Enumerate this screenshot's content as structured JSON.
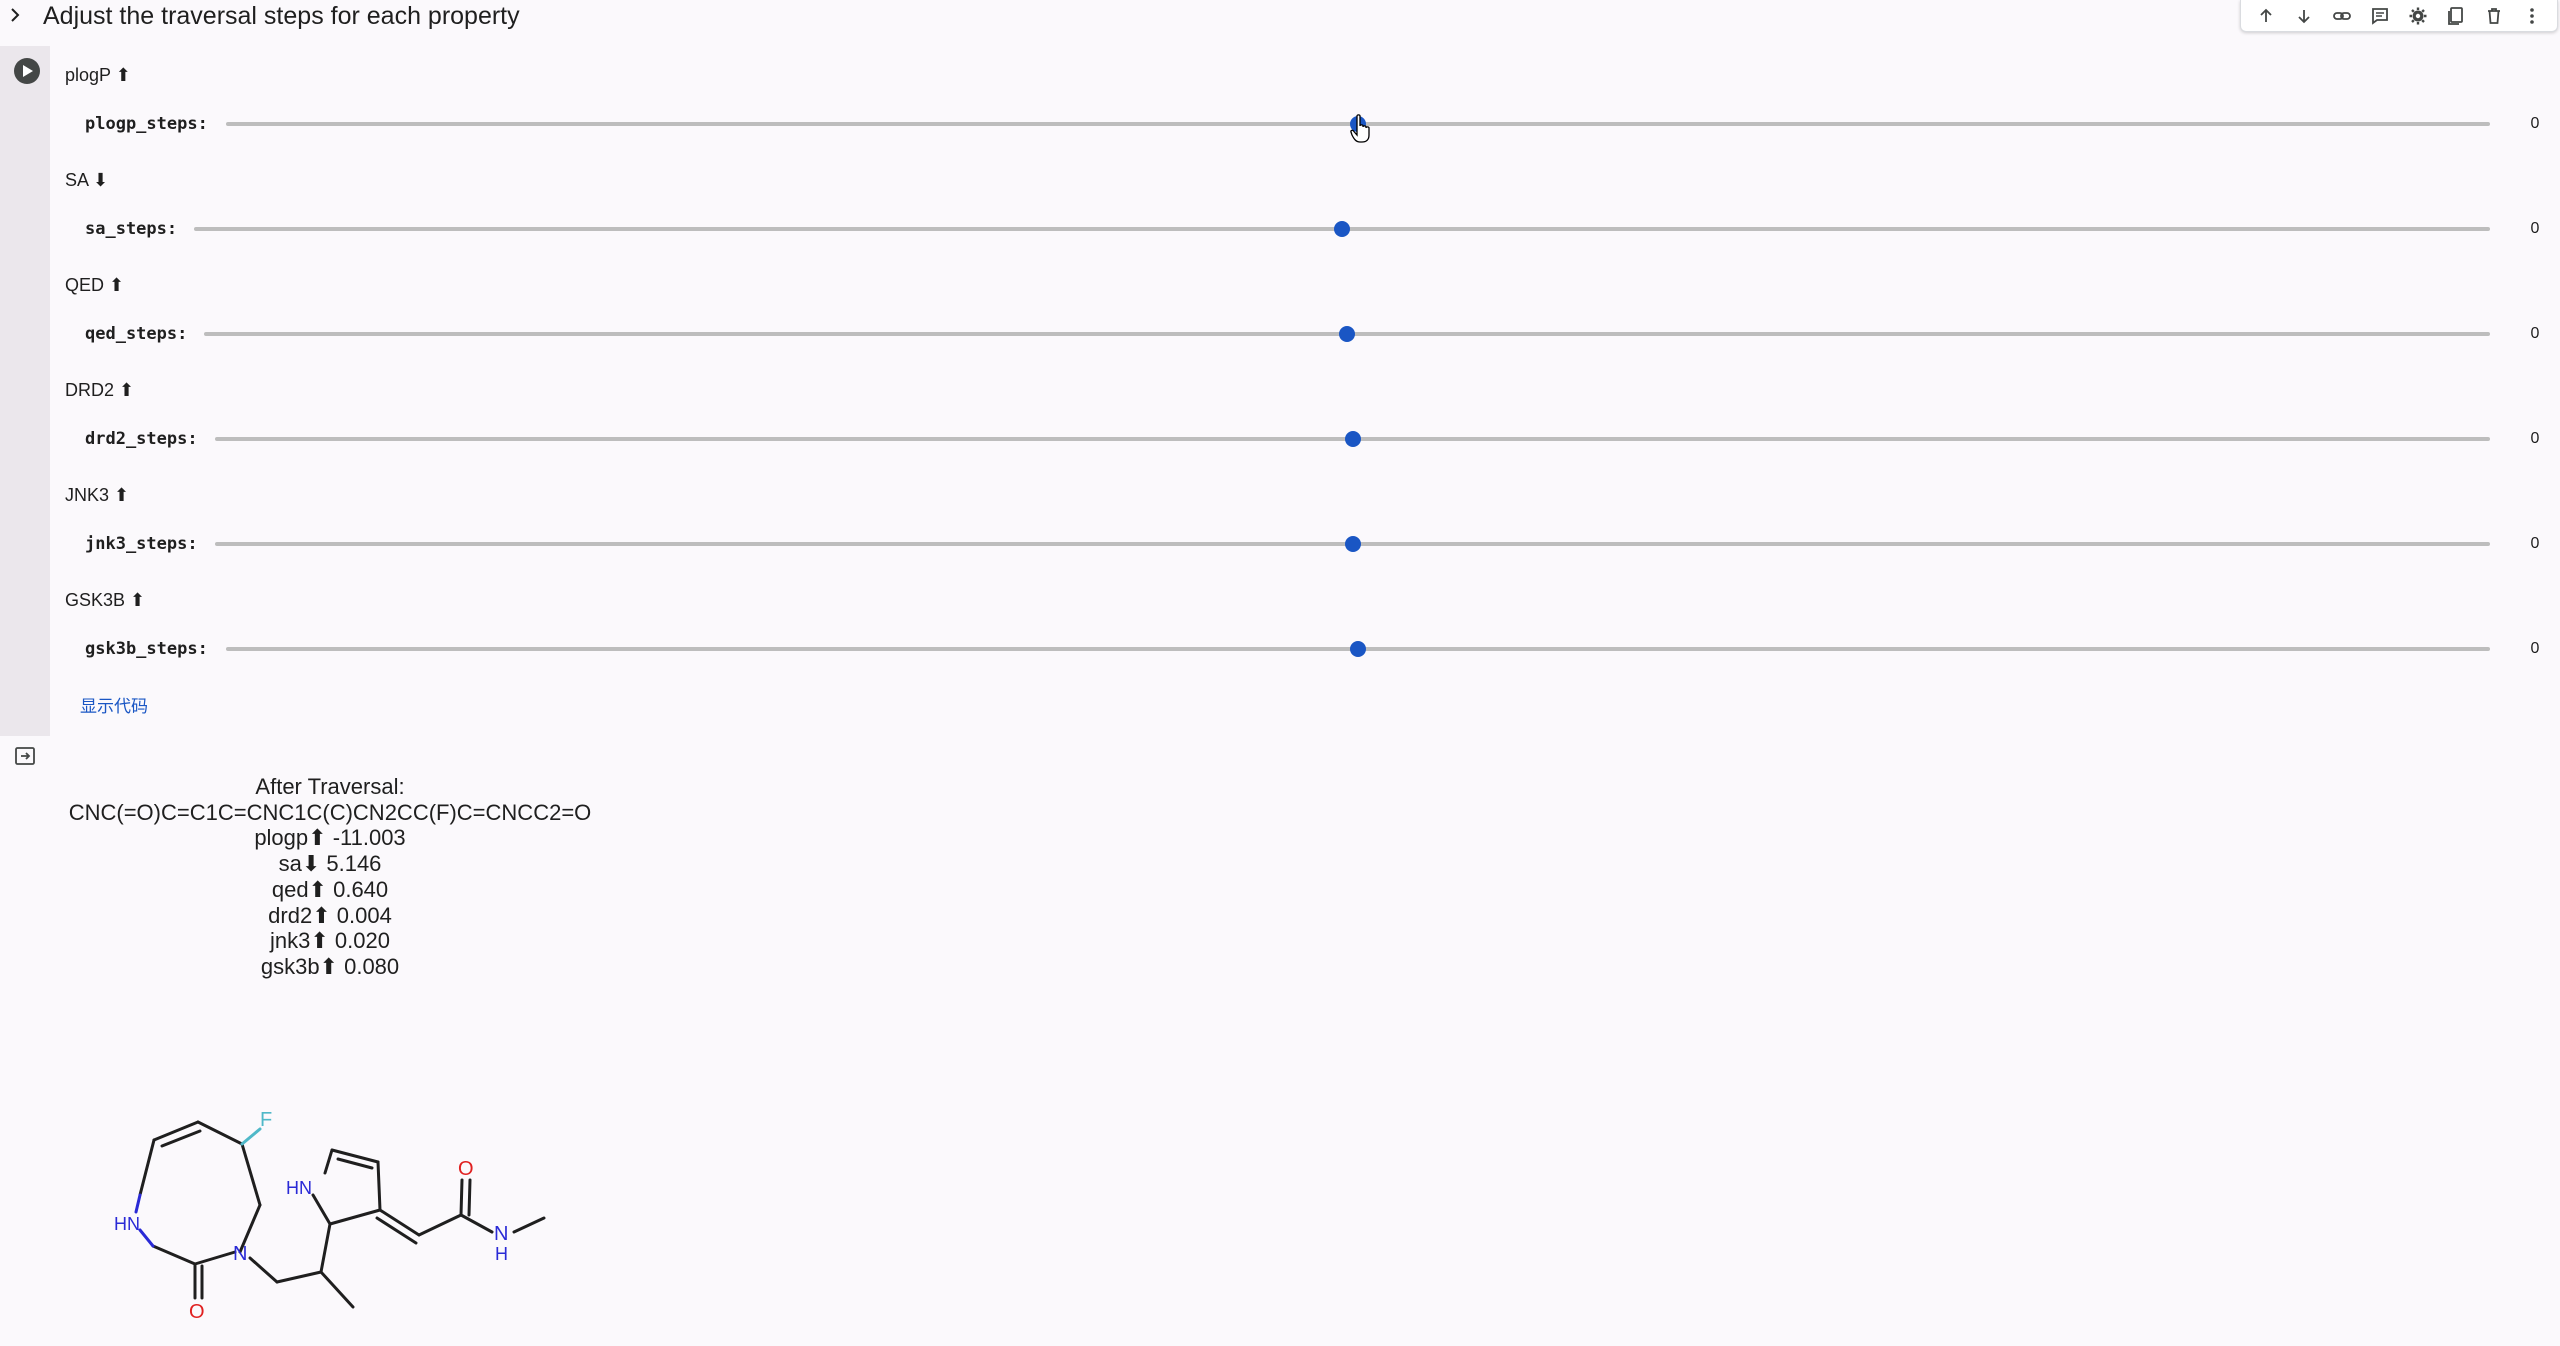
{
  "cell": {
    "title": "Adjust the traversal steps for each property",
    "show_code_label": "显示代码"
  },
  "toolbar": {
    "icons": [
      "arrow-up-icon",
      "arrow-down-icon",
      "link-icon",
      "comment-icon",
      "gear-icon",
      "mirror-cell-icon",
      "trash-icon",
      "more-vert-icon"
    ]
  },
  "sliders": [
    {
      "property": "plogP",
      "arrow": "⬆",
      "label": "plogp_steps:",
      "value": "0"
    },
    {
      "property": "SA",
      "arrow": "⬇",
      "label": "sa_steps:",
      "value": "0"
    },
    {
      "property": "QED",
      "arrow": "⬆",
      "label": "qed_steps:",
      "value": "0"
    },
    {
      "property": "DRD2",
      "arrow": "⬆",
      "label": "drd2_steps:",
      "value": "0"
    },
    {
      "property": "JNK3",
      "arrow": "⬆",
      "label": "jnk3_steps:",
      "value": "0"
    },
    {
      "property": "GSK3B",
      "arrow": "⬆",
      "label": "gsk3b_steps:",
      "value": "0"
    }
  ],
  "output": {
    "lines": [
      "After Traversal:",
      "CNC(=O)C=C1C=CNC1C(C)CN2CC(F)C=CNCC2=O",
      "plogp⬆ -11.003",
      "sa⬇ 5.146",
      "qed⬆ 0.640",
      "drd2⬆ 0.004",
      "jnk3⬆ 0.020",
      "gsk3b⬆ 0.080"
    ]
  },
  "molecule": {
    "atoms": {
      "f": "F",
      "o1": "O",
      "o2": "O",
      "hn1": "HN",
      "hn2": "HN",
      "n1": "N",
      "n2": "N",
      "h": "H"
    },
    "colors": {
      "bond": "#1f1f1f",
      "nitrogen": "#2a2ad6",
      "oxygen": "#e02020",
      "fluorine": "#4fb8c8"
    }
  },
  "colors": {
    "accent": "#1a56c4",
    "gutter": "#ebe7ec",
    "track": "#bdbdbd"
  }
}
